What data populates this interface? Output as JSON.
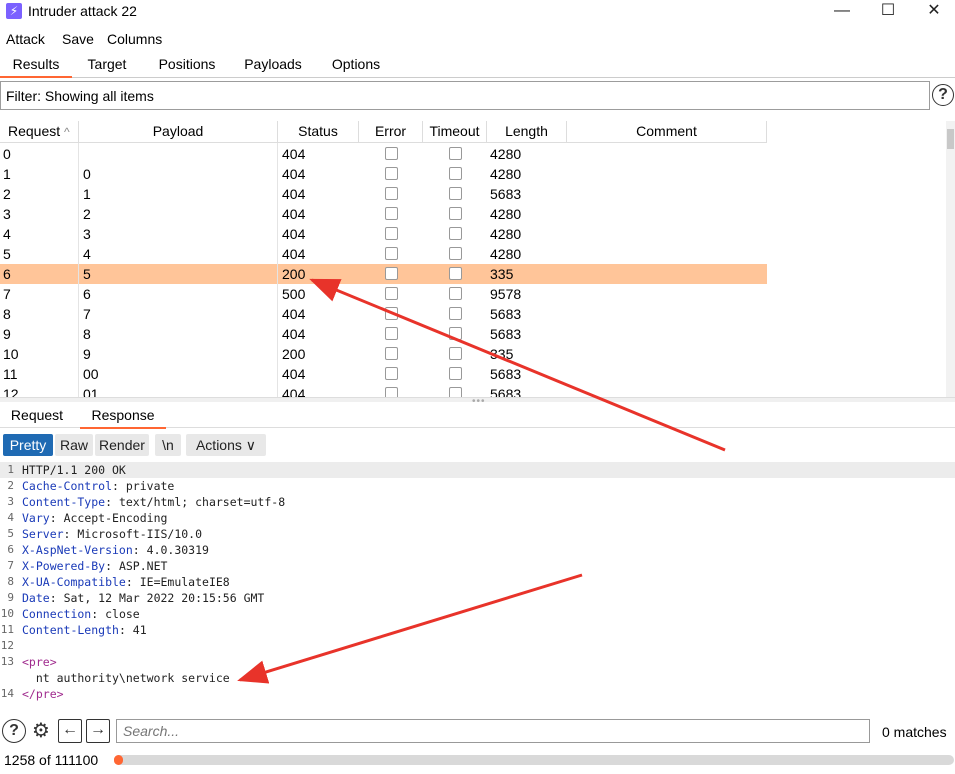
{
  "window": {
    "title": "Intruder attack 22",
    "minimize": "—",
    "maximize": "☐",
    "close": "✕"
  },
  "menu": [
    "Attack",
    "Save",
    "Columns"
  ],
  "top_tabs": [
    "Results",
    "Target",
    "Positions",
    "Payloads",
    "Options"
  ],
  "filter": {
    "text": "Filter: Showing all items"
  },
  "table": {
    "columns": [
      "Request",
      "Payload",
      "Status",
      "Error",
      "Timeout",
      "Length",
      "Comment"
    ],
    "sort_indicator": "^",
    "rows": [
      {
        "request": "0",
        "payload": "",
        "status": "404",
        "length": "4280"
      },
      {
        "request": "1",
        "payload": "0",
        "status": "404",
        "length": "4280"
      },
      {
        "request": "2",
        "payload": "1",
        "status": "404",
        "length": "5683"
      },
      {
        "request": "3",
        "payload": "2",
        "status": "404",
        "length": "4280"
      },
      {
        "request": "4",
        "payload": "3",
        "status": "404",
        "length": "4280"
      },
      {
        "request": "5",
        "payload": "4",
        "status": "404",
        "length": "4280"
      },
      {
        "request": "6",
        "payload": "5",
        "status": "200",
        "length": "335",
        "selected": true
      },
      {
        "request": "7",
        "payload": "6",
        "status": "500",
        "length": "9578"
      },
      {
        "request": "8",
        "payload": "7",
        "status": "404",
        "length": "5683"
      },
      {
        "request": "9",
        "payload": "8",
        "status": "404",
        "length": "5683"
      },
      {
        "request": "10",
        "payload": "9",
        "status": "200",
        "length": "335"
      },
      {
        "request": "11",
        "payload": "00",
        "status": "404",
        "length": "5683"
      },
      {
        "request": "12",
        "payload": "01",
        "status": "404",
        "length": "5683"
      }
    ]
  },
  "bottom_tabs": [
    "Request",
    "Response"
  ],
  "response_toolbar": {
    "pretty": "Pretty",
    "raw": "Raw",
    "render": "Render",
    "newline": "\\n",
    "actions": "Actions ∨"
  },
  "code_lines": [
    {
      "n": "1",
      "key": "HTTP/1.1 200 OK",
      "sep": "",
      "val": ""
    },
    {
      "n": "2",
      "key": "Cache-Control",
      "sep": ": ",
      "val": "private"
    },
    {
      "n": "3",
      "key": "Content-Type",
      "sep": ": ",
      "val": "text/html; charset=utf-8"
    },
    {
      "n": "4",
      "key": "Vary",
      "sep": ": ",
      "val": "Accept-Encoding"
    },
    {
      "n": "5",
      "key": "Server",
      "sep": ": ",
      "val": "Microsoft-IIS/10.0"
    },
    {
      "n": "6",
      "key": "X-AspNet-Version",
      "sep": ": ",
      "val": "4.0.30319"
    },
    {
      "n": "7",
      "key": "X-Powered-By",
      "sep": ": ",
      "val": "ASP.NET"
    },
    {
      "n": "8",
      "key": "X-UA-Compatible",
      "sep": ": ",
      "val": "IE=EmulateIE8"
    },
    {
      "n": "9",
      "key": "Date",
      "sep": ": ",
      "val": "Sat, 12 Mar 2022 20:15:56 GMT"
    },
    {
      "n": "10",
      "key": "Connection",
      "sep": ": ",
      "val": "close"
    },
    {
      "n": "11",
      "key": "Content-Length",
      "sep": ": ",
      "val": "41"
    },
    {
      "n": "12",
      "key": "",
      "sep": "",
      "val": ""
    },
    {
      "n": "13",
      "tag": "<pre>"
    },
    {
      "n": "",
      "body": "  nt authority\\network service"
    },
    {
      "n": "14",
      "tag": "</pre>"
    }
  ],
  "search": {
    "placeholder": "Search...",
    "matches": "0 matches"
  },
  "status": {
    "progress_label": "1258 of 111100",
    "progress_fraction": 0.0113
  },
  "colors": {
    "accent": "#ff6633",
    "selected_row": "#ffc599",
    "active_button": "#1f6ab3",
    "arrow": "#e8332a"
  }
}
